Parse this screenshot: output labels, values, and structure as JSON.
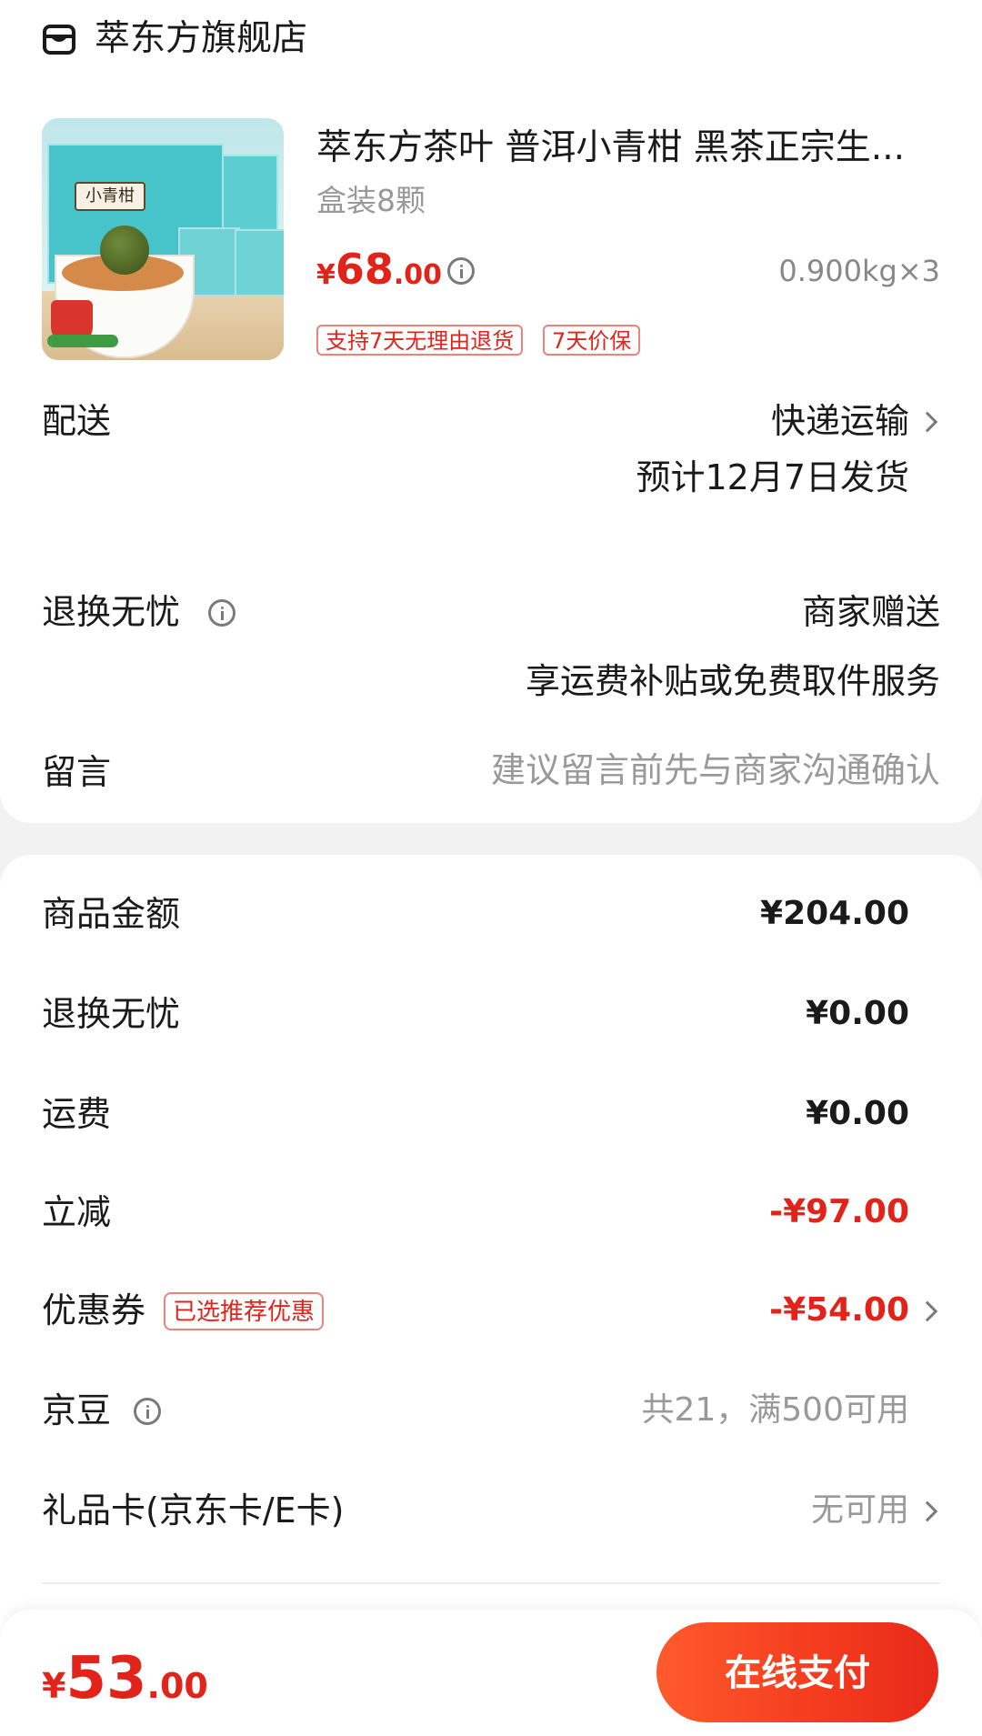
{
  "store": {
    "icon": "store-icon",
    "name": "萃东方旗舰店"
  },
  "product": {
    "title": "萃东方茶叶 普洱小青柑 黑茶正宗生...",
    "spec": "盒装8颗",
    "price": {
      "currency": "¥",
      "integer": "68",
      "decimal": ".00"
    },
    "weight_qty": "0.900kg×3",
    "tags": [
      "支持7天无理由退货",
      "7天价保"
    ],
    "image_label": "小青柑"
  },
  "delivery": {
    "label": "配送",
    "method": "快递运输",
    "eta": "预计12月7日发货"
  },
  "returns": {
    "label": "退换无忧",
    "value": "商家赠送",
    "sub": "享运费补贴或免费取件服务"
  },
  "message": {
    "label": "留言",
    "placeholder": "建议留言前先与商家沟通确认"
  },
  "summary": {
    "goods": {
      "label": "商品金额",
      "value": "¥204.00"
    },
    "returns_fee": {
      "label": "退换无忧",
      "value": "¥0.00"
    },
    "shipping": {
      "label": "运费",
      "value": "¥0.00"
    },
    "instant_discount": {
      "label": "立减",
      "value": "-¥97.00"
    },
    "coupon": {
      "label": "优惠券",
      "tag": "已选推荐优惠",
      "value": "-¥54.00"
    },
    "jingdou": {
      "label": "京豆",
      "value": "共21，满500可用"
    },
    "gift_card": {
      "label": "礼品卡(京东卡/E卡)",
      "value": "无可用"
    }
  },
  "footer": {
    "total": {
      "currency": "¥",
      "integer": "53",
      "decimal": ".00"
    },
    "pay_label": "在线支付"
  },
  "colors": {
    "accent": "#e2231a",
    "button": "#f33b1e"
  }
}
